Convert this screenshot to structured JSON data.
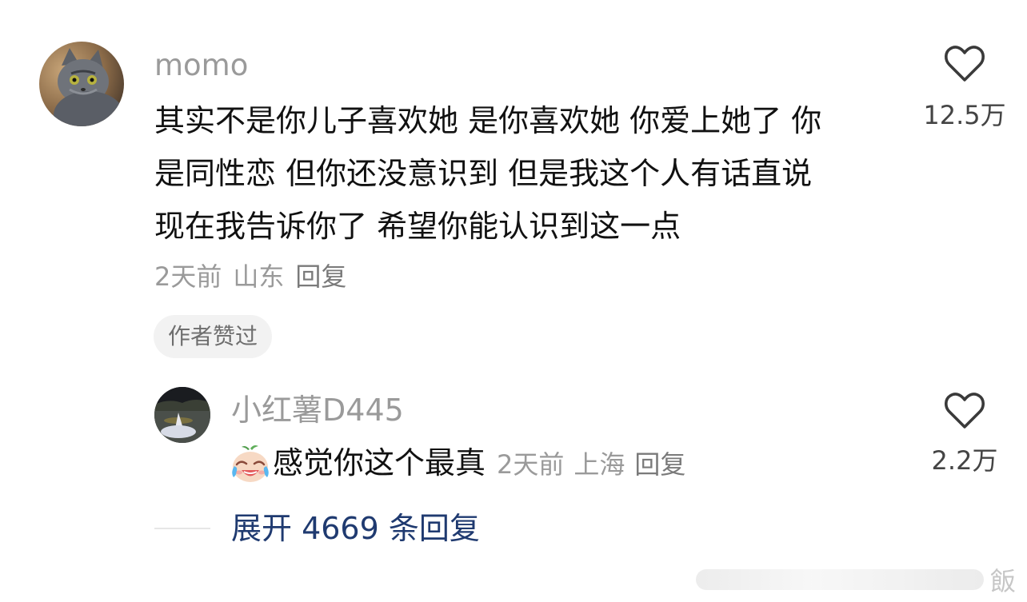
{
  "comment": {
    "username": "momo",
    "avatar_icon": "cat-avatar",
    "text_lines": [
      "其实不是你儿子喜欢她 是你喜欢她 你爱上她了 你",
      "是同性恋 但你还没意识到 但是我这个人有话直说",
      "现在我告诉你了 希望你能认识到这一点"
    ],
    "time": "2天前",
    "location": "山东",
    "reply_label": "回复",
    "author_liked_badge": "作者赞过",
    "like_icon": "heart-outline-icon",
    "like_count": "12.5万"
  },
  "reply": {
    "username": "小红薯D445",
    "avatar_icon": "lake-avatar",
    "emoji_icon": "crying-laughing-emoji",
    "text": "感觉你这个最真",
    "time": "2天前",
    "location": "上海",
    "reply_label": "回复",
    "like_icon": "heart-outline-icon",
    "like_count": "2.2万"
  },
  "expand_label": "展开 4669 条回复",
  "watermark_char": "飯",
  "colors": {
    "text": "#111111",
    "muted": "#9a9a9a",
    "link": "#1f3a70",
    "badge_bg": "#f2f2f2"
  }
}
